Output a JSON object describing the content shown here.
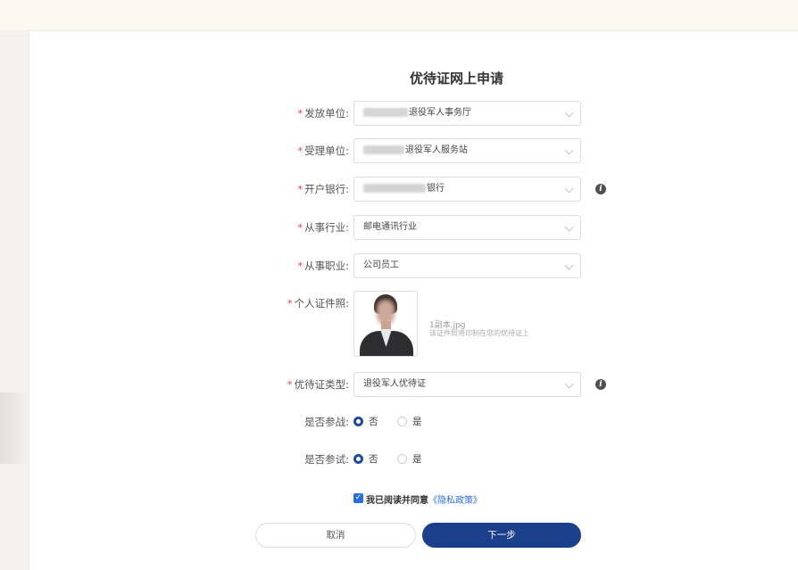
{
  "form": {
    "title": "优待证网上申请",
    "required_mark": "*",
    "fields": {
      "issuing_unit": {
        "label": "发放单位:",
        "value": "退役军人事务厅"
      },
      "accepting_unit": {
        "label": "受理单位:",
        "value": "退役军人服务站"
      },
      "bank": {
        "label": "开户银行:",
        "value": "银行"
      },
      "industry": {
        "label": "从事行业:",
        "value": "邮电通讯行业"
      },
      "occupation": {
        "label": "从事职业:",
        "value": "公司员工"
      },
      "id_photo": {
        "label": "个人证件照:",
        "file_name": "1副本.jpg",
        "hint": "该证件照将印制在您的优待证上"
      },
      "card_type": {
        "label": "优待证类型:",
        "value": "退役军人优待证"
      },
      "war_participation": {
        "label": "是否参战:",
        "options": [
          "否",
          "是"
        ],
        "selected": "否"
      },
      "nuclear_test": {
        "label": "是否参试:",
        "options": [
          "否",
          "是"
        ],
        "selected": "否"
      }
    },
    "agreement": {
      "checked": true,
      "check_glyph": "✓",
      "text": "我已阅读并同意",
      "link": "《隐私政策》"
    },
    "buttons": {
      "cancel": "取消",
      "next": "下一步"
    },
    "info_glyph": "i"
  },
  "colors": {
    "primary": "#1c3f8c",
    "required": "#e24b4b",
    "link": "#2a6ee0",
    "page_bg": "#f3f1ee"
  },
  "icons": [
    "chevron-down-icon",
    "info-icon",
    "checkbox-checked-icon"
  ]
}
